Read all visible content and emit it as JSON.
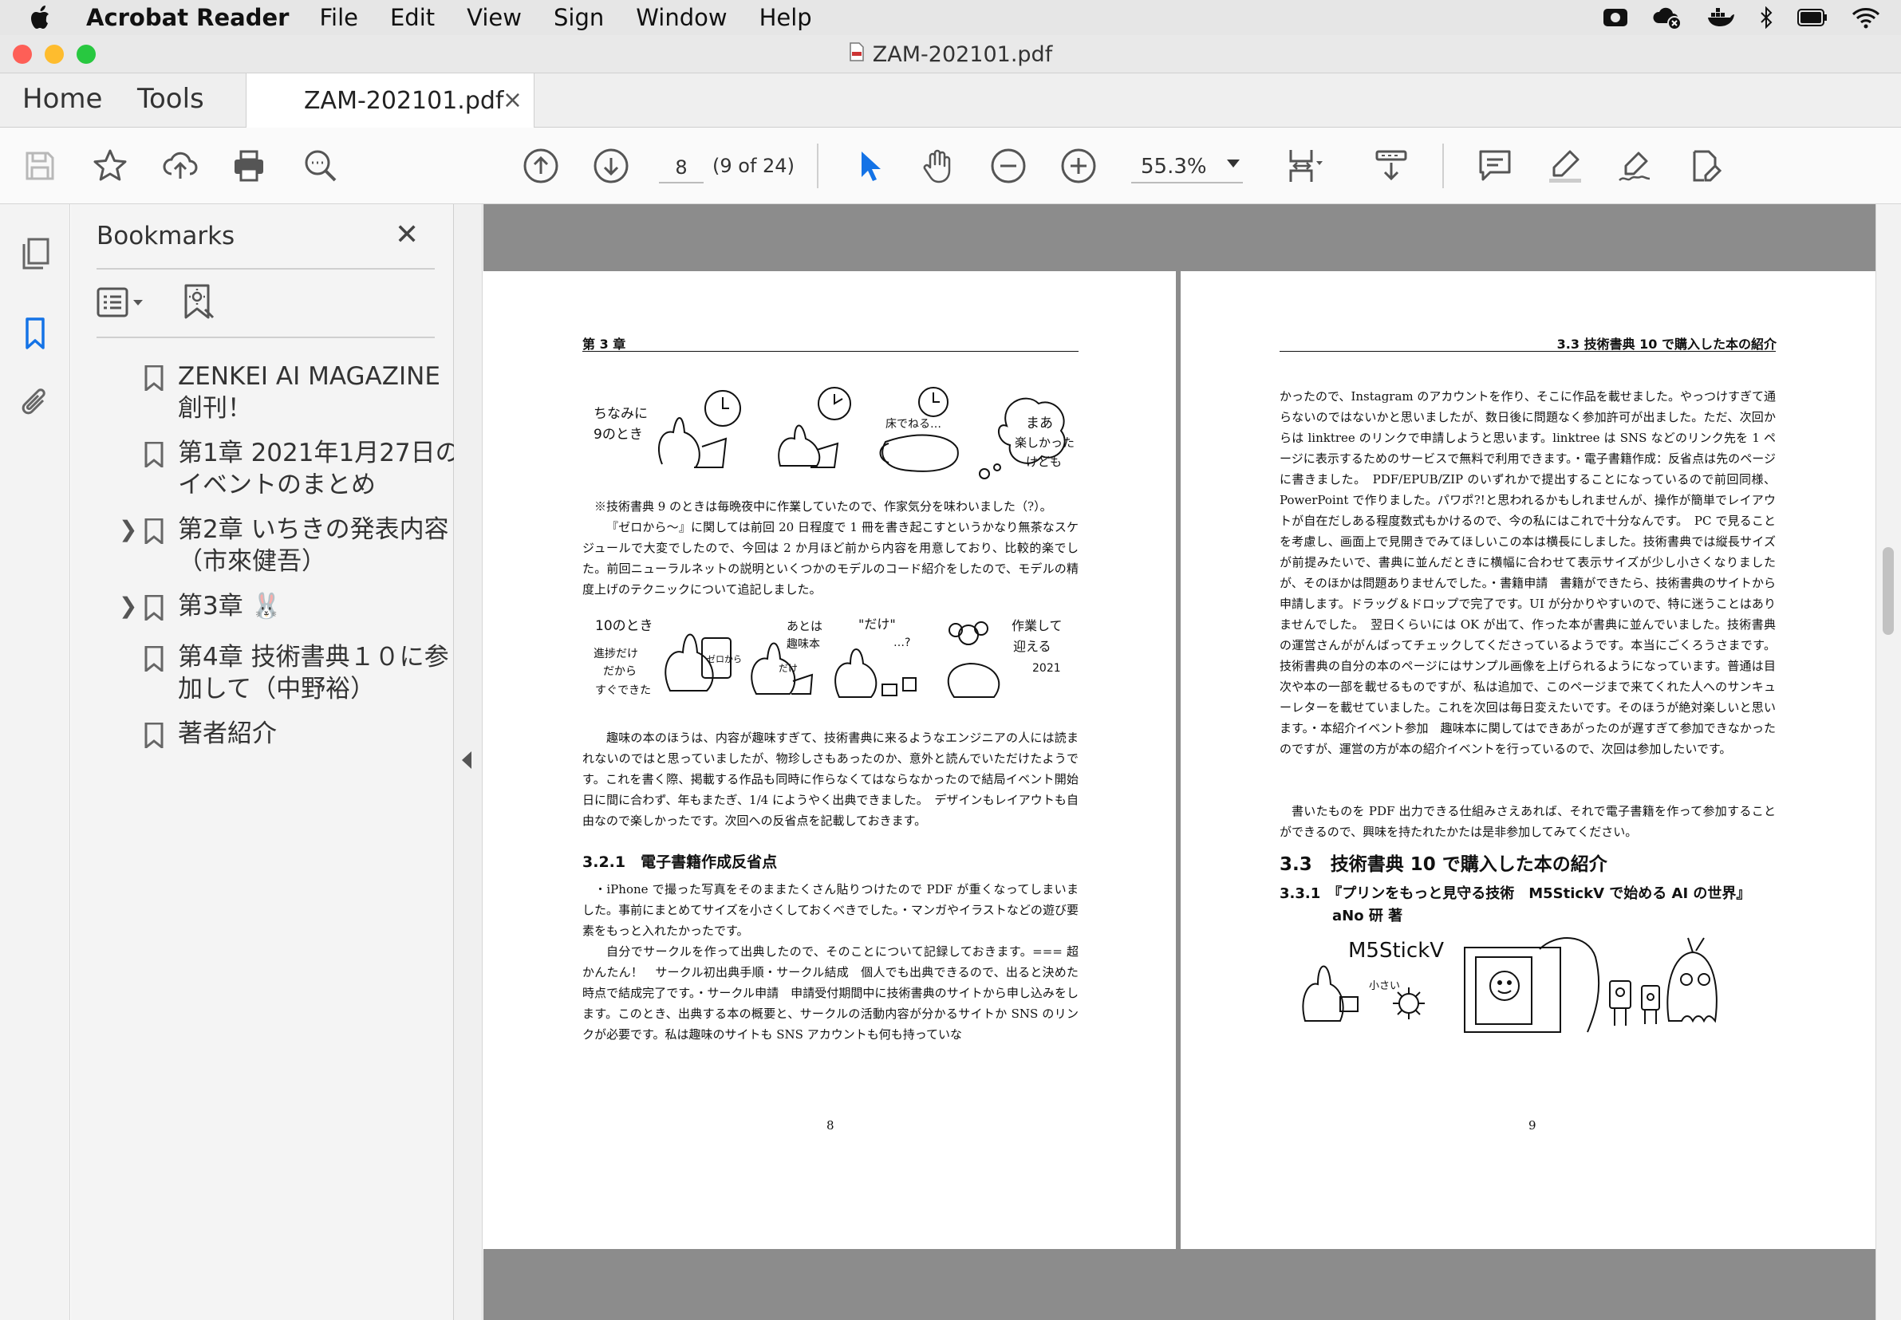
{
  "menubar": {
    "app_name": "Acrobat Reader",
    "items": [
      "File",
      "Edit",
      "View",
      "Sign",
      "Window",
      "Help"
    ]
  },
  "window": {
    "title": "ZAM-202101.pdf"
  },
  "tabs": {
    "home": "Home",
    "tools": "Tools",
    "document": "ZAM-202101.pdf",
    "close": "×"
  },
  "toolbar": {
    "page_number": "8",
    "page_of": "(9 of 24)",
    "zoom": "55.3%",
    "icons": [
      "save-icon",
      "star-icon",
      "upload-icon",
      "print-icon",
      "search-zoom-icon",
      "page-up-icon",
      "page-down-icon",
      "select-arrow-icon",
      "hand-icon",
      "zoom-out-icon",
      "zoom-in-icon",
      "page-fit-icon",
      "scroll-mode-icon",
      "comment-icon",
      "highlight-icon",
      "sign-icon",
      "fill-sign-icon"
    ]
  },
  "bookmarks": {
    "title": "Bookmarks",
    "close": "✕",
    "items": [
      {
        "label": "ZENKEI AI MAGAZINE 創刊！",
        "expandable": false
      },
      {
        "label": "第1章 2021年1月27日のイベントのまとめ",
        "expandable": false
      },
      {
        "label": "第2章 いちきの発表内容（市來健吾）",
        "expandable": true
      },
      {
        "label": "第3章 🐰",
        "expandable": true
      },
      {
        "label": "第4章 技術書典１０に参加して（中野裕）",
        "expandable": false
      },
      {
        "label": "著者紹介",
        "expandable": false
      }
    ]
  },
  "pdf": {
    "left": {
      "header": "第 3 章",
      "para1": "※技術書典 9 のときは毎晩夜中に作業していたので、作家気分を味わいました（?）。",
      "para2": "『ゼロから〜』に関しては前回 20 日程度で 1 冊を書き起こすというかなり無茶なスケジュールで大変でしたので、今回は 2 か月ほど前から内容を用意しており、比較的楽でした。前回ニューラルネットの説明といくつかのモデルのコード紹介をしたので、モデルの精度上げのテクニックについて追記しました。",
      "para3": "趣味の本のほうは、内容が趣味すぎて、技術書典に来るようなエンジニアの人には読まれないのではと思っていましたが、物珍しさもあったのか、意外と読んでいただけたようです。これを書く際、掲載する作品も同時に作らなくてはならなかったので結局イベント開始日に間に合わず、年もまたぎ、1/4 にようやく出典できました。　デザインもレイアウトも自由なので楽しかったです。次回への反省点を記載しておきます。",
      "section": "3.2.1　電子書籍作成反省点",
      "para4": "・iPhone で撮った写真をそのままたくさん貼りつけたので PDF が重くなってしまいました。事前にまとめてサイズを小さくしておくべきでした。・マンガやイラストなどの遊び要素をもっと入れたかったです。",
      "para5": "自分でサークルを作って出典したので、そのことについて記録しておきます。=== 超かんたん！　サークル初出典手順・サークル結成　個人でも出典できるので、出ると決めた時点で結成完了です。・サークル申請　申請受付期間中に技術書典のサイトから申し込みをします。このとき、出典する本の概要と、サークルの活動内容が分かるサイトか SNS のリンクが必要です。私は趣味のサイトも SNS アカウントも何も持っていな",
      "page_number": "8"
    },
    "right": {
      "header": "3.3 技術書典 10 で購入した本の紹介",
      "para1": "かったので、Instagram のアカウントを作り、そこに作品を載せました。やっつけすぎて通らないのではないかと思いましたが、数日後に問題なく参加許可が出ました。ただ、次回からは linktree のリンクで申請しようと思います。linktree は SNS などのリンク先を 1 ページに表示するためのサービスで無料で利用できます。・電子書籍作成：反省点は先のページに書きました。　PDF/EPUB/ZIP のいずれかで提出することになっているので前回同様、PowerPoint で作りました。パワポ?!と思われるかもしれませんが、操作が簡単でレイアウトが自在だしある程度数式もかけるので、今の私にはこれで十分なんです。　PC で見ることを考慮し、画面上で見開きでみてほしいこの本は横長にしました。技術書典では縦長サイズが前提みたいで、書典に並んだときに横幅に合わせて表示サイズが少し小さくなりましたが、そのほかは問題ありませんでした。・書籍申請　書籍ができたら、技術書典のサイトから申請します。ドラッグ＆ドロップで完了です。UI が分かりやすいので、特に迷うことはありませんでした。　翌日くらいには OK が出て、作った本が書典に並んでいました。技術書典の運営さんががんばってチェックしてくださっているようです。本当にごくろうさまです。技術書典の自分の本のページにはサンプル画像を上げられるようになっています。普通は目次や本の一部を載せるものですが、私は追加で、このページまで来てくれた人へのサンキューレターを載せていました。これを次回は毎日変えたいです。そのほうが絶対楽しいと思います。・本紹介イベント参加　趣味本に関してはできあがったのが遅すぎて参加できなかったのですが、運営の方が本の紹介イベントを行っているので、次回は参加したいです。",
      "para2": "書いたものを PDF 出力できる仕組みさえあれば、それで電子書籍を作って参加することができるので、興味を持たれたかたは是非参加してみてください。",
      "section": "3.3　技術書典 10 で購入した本の紹介",
      "subsection": "3.3.1　『プリンをもっと見守る技術　M5StickV で始める AI の世界』",
      "author": "aNo 研 著",
      "page_number": "9"
    },
    "illustrations": {
      "top_left": [
        "ちなみに",
        "9のとき",
        "床でねる…",
        "まあ",
        "楽しかった",
        "けども"
      ],
      "mid_left": [
        "10のとき",
        "進捗だけ",
        "だから",
        "すぐできた",
        "ゼロから",
        "あとは",
        "趣味本",
        "だけ",
        "\"だけ\"",
        "…?",
        "作業して",
        "迎える",
        "2021"
      ],
      "right": [
        "M5StickV",
        "小さい"
      ]
    }
  },
  "colors": {
    "accent": "#1473e6",
    "viewport_bg": "#8c8c8c",
    "traffic_red": "#fe5f57",
    "traffic_yellow": "#febc2e",
    "traffic_green": "#28c840"
  }
}
